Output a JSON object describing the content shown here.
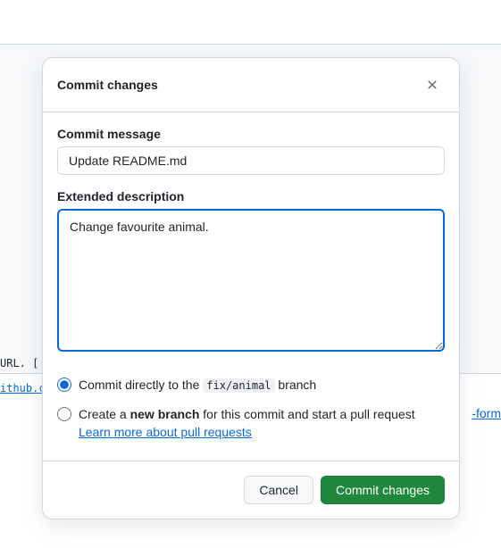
{
  "background": {
    "url_label": "URL. [",
    "link_left": "ithub.c",
    "link_right": "-form"
  },
  "modal": {
    "title": "Commit changes",
    "commit_message_label": "Commit message",
    "commit_message_value": "Update README.md",
    "extended_description_label": "Extended description",
    "extended_description_value": "Change favourite animal.",
    "radio": {
      "direct_prefix": "Commit directly to the ",
      "direct_branch": "fix/animal",
      "direct_suffix": " branch",
      "new_prefix": "Create a ",
      "new_bold": "new branch",
      "new_suffix": " for this commit and start a pull request ",
      "learn_more": "Learn more about pull requests"
    },
    "footer": {
      "cancel": "Cancel",
      "commit": "Commit changes"
    }
  }
}
